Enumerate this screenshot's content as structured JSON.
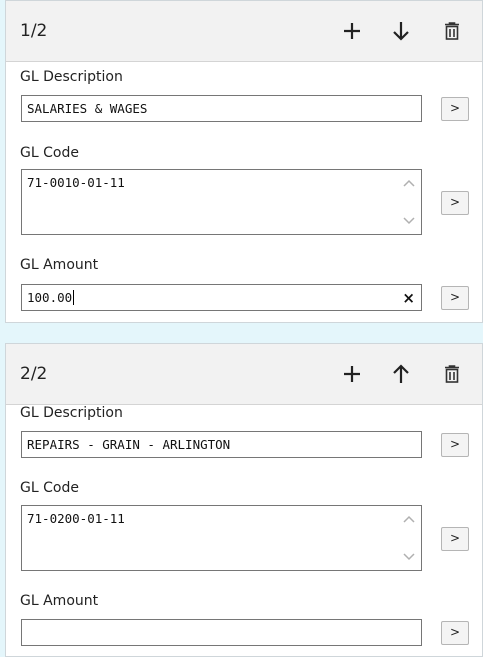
{
  "entries": [
    {
      "counter": "1/2",
      "description_label": "GL Description",
      "description_value": "SALARIES & WAGES",
      "code_label": "GL Code",
      "code_value": "71-0010-01-11",
      "amount_label": "GL Amount",
      "amount_value": "100.00",
      "go_label": ">",
      "clear_label": "×",
      "move_direction": "down"
    },
    {
      "counter": "2/2",
      "description_label": "GL Description",
      "description_value": "REPAIRS - GRAIN - ARLINGTON",
      "code_label": "GL Code",
      "code_value": "71-0200-01-11",
      "amount_label": "GL Amount",
      "amount_value": "",
      "go_label": ">",
      "move_direction": "up"
    }
  ],
  "icons": [
    "add-icon",
    "move-down-icon",
    "move-up-icon",
    "delete-icon",
    "clear-icon",
    "scroll-up-icon",
    "scroll-down-icon"
  ]
}
